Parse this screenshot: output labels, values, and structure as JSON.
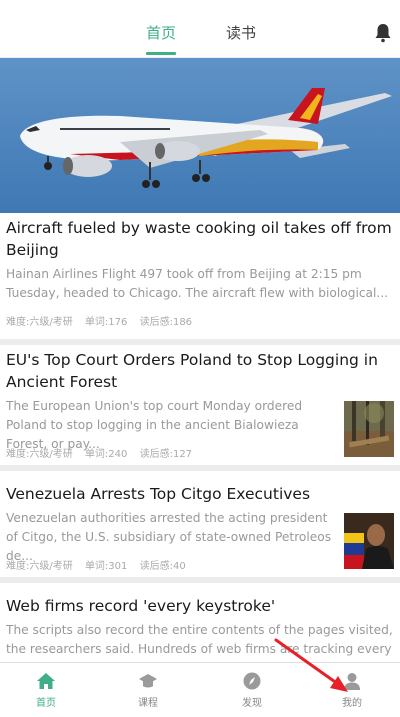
{
  "tabs": [
    {
      "label": "首页",
      "active": true
    },
    {
      "label": "读书",
      "active": false
    }
  ],
  "articles": [
    {
      "title": "Aircraft fueled by waste cooking oil takes off from Beijing",
      "summary": "Hainan Airlines Flight 497 took off from Beijing at 2:15 pm Tuesday, headed to Chicago. The aircraft flew with biological...",
      "difficulty": "难度:六级/考研",
      "words": "单词:176",
      "readers": "读后感:186"
    },
    {
      "title": "EU's Top Court Orders Poland to Stop Logging in Ancient Forest",
      "summary": "The European Union's top court Monday ordered Poland to stop logging in the ancient Bialowieza Forest, or pay...",
      "difficulty": "难度:六级/考研",
      "words": "单词:240",
      "readers": "读后感:127"
    },
    {
      "title": "Venezuela Arrests Top Citgo Executives",
      "summary": "Venezuelan authorities arrested the acting president of Citgo, the U.S. subsidiary of state-owned Petroleos de...",
      "difficulty": "难度:六级/考研",
      "words": "单词:301",
      "readers": "读后感:40"
    },
    {
      "title": "Web firms record 'every keystroke'",
      "summary": "The scripts also record the entire contents of the pages visited, the researchers said. Hundreds of web firms are tracking every single..."
    }
  ],
  "nav": [
    {
      "label": "首页",
      "icon": "home-icon",
      "active": true
    },
    {
      "label": "课程",
      "icon": "graduation-cap-icon",
      "active": false
    },
    {
      "label": "发现",
      "icon": "compass-icon",
      "active": false
    },
    {
      "label": "我的",
      "icon": "user-icon",
      "active": false
    }
  ],
  "colors": {
    "accent": "#3fae8b",
    "arrow": "#e8202a"
  }
}
